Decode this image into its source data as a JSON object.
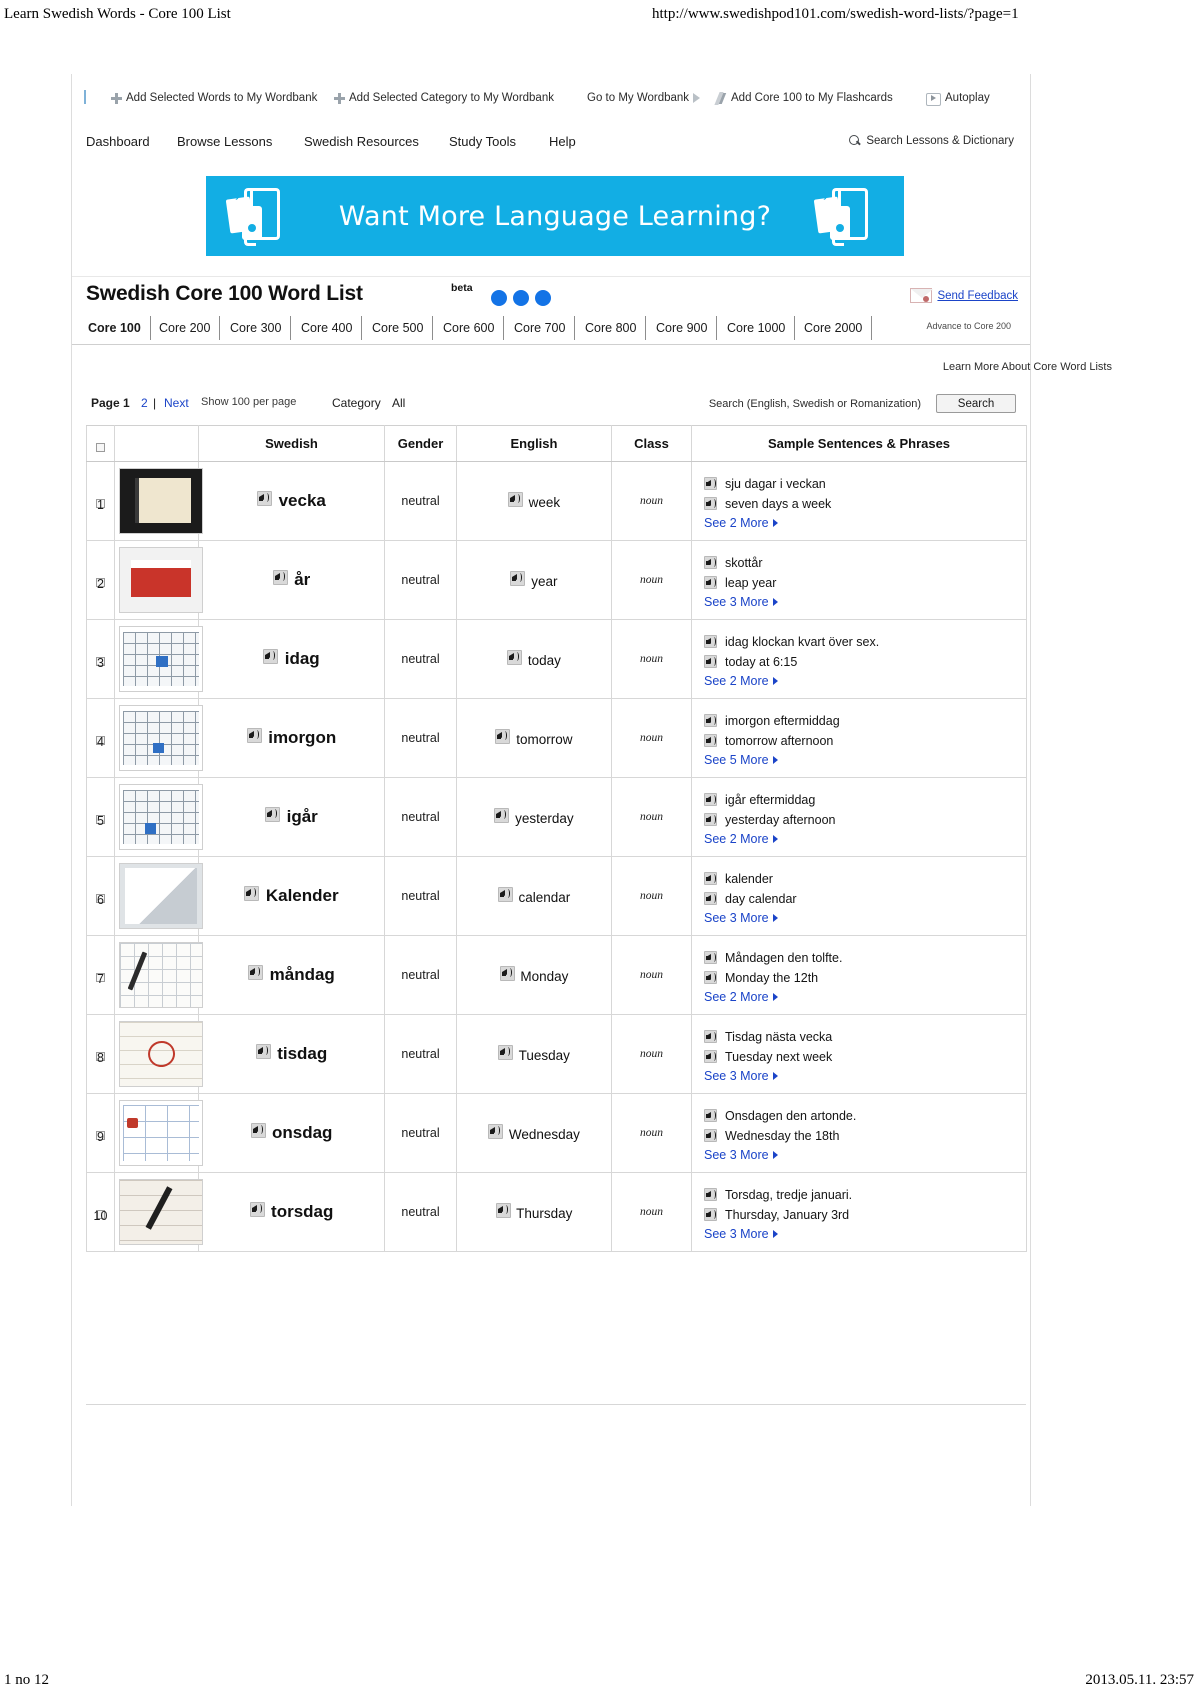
{
  "print": {
    "header_title": "Learn Swedish Words - Core 100 List",
    "header_url": "http://www.swedishpod101.com/swedish-word-lists/?page=1",
    "footer_left": "1 no 12",
    "footer_right": "2013.05.11. 23:57"
  },
  "wordbank_toolbar": [
    {
      "label": "Add Selected Words to My Wordbank",
      "icon": "plus-icon"
    },
    {
      "label": "Add Selected Category to My Wordbank",
      "icon": "plus-icon"
    },
    {
      "label": "Go to My Wordbank",
      "icon": "arrow-right-icon"
    },
    {
      "label": "Add Core 100 to My Flashcards",
      "icon": "lightning-icon"
    },
    {
      "label": "Autoplay",
      "icon": "play-icon"
    }
  ],
  "site_nav": {
    "items": [
      "Dashboard",
      "Browse Lessons",
      "Swedish Resources",
      "Study Tools",
      "Help"
    ],
    "search": "Search Lessons & Dictionary"
  },
  "banner": {
    "text": "Want More Language Learning?",
    "color": "#12aee4"
  },
  "list_header": {
    "title": "Swedish Core 100 Word List",
    "beta": "beta",
    "dots": 3,
    "dot_color": "#1373e6",
    "feedback": "Send Feedback"
  },
  "core_tabs": {
    "tabs": [
      "Core 100",
      "Core 200",
      "Core 300",
      "Core 400",
      "Core 500",
      "Core 600",
      "Core 700",
      "Core 800",
      "Core 900",
      "Core 1000",
      "Core 2000"
    ],
    "active": "Core 100",
    "advance_note": "Advance to Core 200",
    "learn_more": "Learn More About Core Word Lists"
  },
  "controls": {
    "page_label": "Page 1",
    "page_2": "2",
    "separator": "|",
    "next": "Next",
    "show_per_page": "Show 100 per page",
    "category_label": "Category",
    "category_value": "All",
    "search_label": "Search (English, Swedish or Romanization)",
    "search_button": "Search"
  },
  "table": {
    "columns": [
      "",
      "",
      "Swedish",
      "Gender",
      "English",
      "Class",
      "Sample Sentences & Phrases"
    ],
    "rows": [
      {
        "num": "1",
        "thumb": "tn-planner",
        "swedish": "vecka",
        "gender": "neutral",
        "english": "week",
        "class": "noun",
        "samples": [
          "sju dagar i veckan",
          "seven days a week"
        ],
        "more": "See 2 More"
      },
      {
        "num": "2",
        "thumb": "tn-deskcal",
        "swedish": "år",
        "gender": "neutral",
        "english": "year",
        "class": "noun",
        "samples": [
          "skottår",
          "leap year"
        ],
        "more": "See 3 More"
      },
      {
        "num": "3",
        "thumb": "tn-grid",
        "swedish": "idag",
        "gender": "neutral",
        "english": "today",
        "class": "noun",
        "samples": [
          "idag klockan kvart över sex.",
          "today at 6:15"
        ],
        "more": "See 2 More"
      },
      {
        "num": "4",
        "thumb": "tn-grid g4",
        "swedish": "imorgon",
        "gender": "neutral",
        "english": "tomorrow",
        "class": "noun",
        "samples": [
          "imorgon eftermiddag",
          "tomorrow afternoon"
        ],
        "more": "See 5 More"
      },
      {
        "num": "5",
        "thumb": "tn-grid g5",
        "swedish": "igår",
        "gender": "neutral",
        "english": "yesterday",
        "class": "noun",
        "samples": [
          "igår eftermiddag",
          "yesterday afternoon"
        ],
        "more": "See 2 More"
      },
      {
        "num": "6",
        "thumb": "tn-peel",
        "swedish": "Kalender",
        "gender": "neutral",
        "english": "calendar",
        "class": "noun",
        "samples": [
          "kalender",
          "day calendar"
        ],
        "more": "See 3 More"
      },
      {
        "num": "7",
        "thumb": "tn-pen",
        "swedish": "måndag",
        "gender": "neutral",
        "english": "Monday",
        "class": "noun",
        "samples": [
          "Måndagen den tolfte.",
          "Monday the 12th"
        ],
        "more": "See 2 More"
      },
      {
        "num": "8",
        "thumb": "tn-circ",
        "swedish": "tisdag",
        "gender": "neutral",
        "english": "Tuesday",
        "class": "noun",
        "samples": [
          "Tisdag nästa vecka",
          "Tuesday next week"
        ],
        "more": "See 3 More"
      },
      {
        "num": "9",
        "thumb": "tn-bluecal",
        "swedish": "onsdag",
        "gender": "neutral",
        "english": "Wednesday",
        "class": "noun",
        "samples": [
          "Onsdagen den artonde.",
          "Wednesday the 18th"
        ],
        "more": "See 3 More"
      },
      {
        "num": "10",
        "thumb": "tn-redpen",
        "swedish": "torsdag",
        "gender": "neutral",
        "english": "Thursday",
        "class": "noun",
        "samples": [
          "Torsdag, tredje januari.",
          "Thursday, January 3rd"
        ],
        "more": "See 3 More"
      }
    ]
  }
}
